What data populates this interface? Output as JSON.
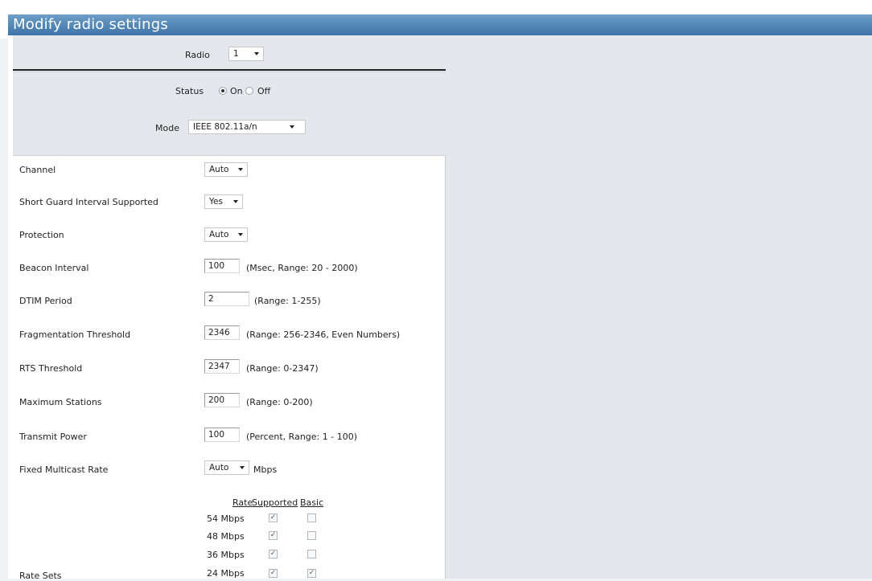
{
  "header": {
    "title": "Modify radio settings"
  },
  "radio": {
    "label": "Radio",
    "value": "1"
  },
  "status": {
    "label": "Status",
    "on_label": "On",
    "off_label": "Off",
    "selected": "On"
  },
  "mode": {
    "label": "Mode",
    "value": "IEEE 802.11a/n"
  },
  "fields": {
    "channel": {
      "label": "Channel",
      "value": "Auto"
    },
    "sgi": {
      "label": "Short Guard Interval Supported",
      "value": "Yes"
    },
    "protection": {
      "label": "Protection",
      "value": "Auto"
    },
    "beacon": {
      "label": "Beacon Interval",
      "value": "100",
      "hint": "(Msec, Range: 20 - 2000)"
    },
    "dtim": {
      "label": "DTIM Period",
      "value": "2",
      "hint": "(Range: 1-255)"
    },
    "frag": {
      "label": "Fragmentation Threshold",
      "value": "2346",
      "hint": "(Range: 256-2346, Even Numbers)"
    },
    "rts": {
      "label": "RTS Threshold",
      "value": "2347",
      "hint": "(Range: 0-2347)"
    },
    "maxsta": {
      "label": "Maximum Stations",
      "value": "200",
      "hint": "(Range: 0-200)"
    },
    "txpower": {
      "label": "Transmit Power",
      "value": "100",
      "hint": "(Percent, Range: 1 - 100)"
    },
    "mcast": {
      "label": "Fixed Multicast Rate",
      "value": "Auto",
      "unit": "Mbps"
    }
  },
  "rate_sets": {
    "label": "Rate Sets",
    "headers": {
      "rate": "Rate",
      "supported": "Supported",
      "basic": "Basic"
    },
    "rows": [
      {
        "rate": "54 Mbps",
        "supported": true,
        "basic": false
      },
      {
        "rate": "48 Mbps",
        "supported": true,
        "basic": false
      },
      {
        "rate": "36 Mbps",
        "supported": true,
        "basic": false
      },
      {
        "rate": "24 Mbps",
        "supported": true,
        "basic": true
      }
    ]
  }
}
